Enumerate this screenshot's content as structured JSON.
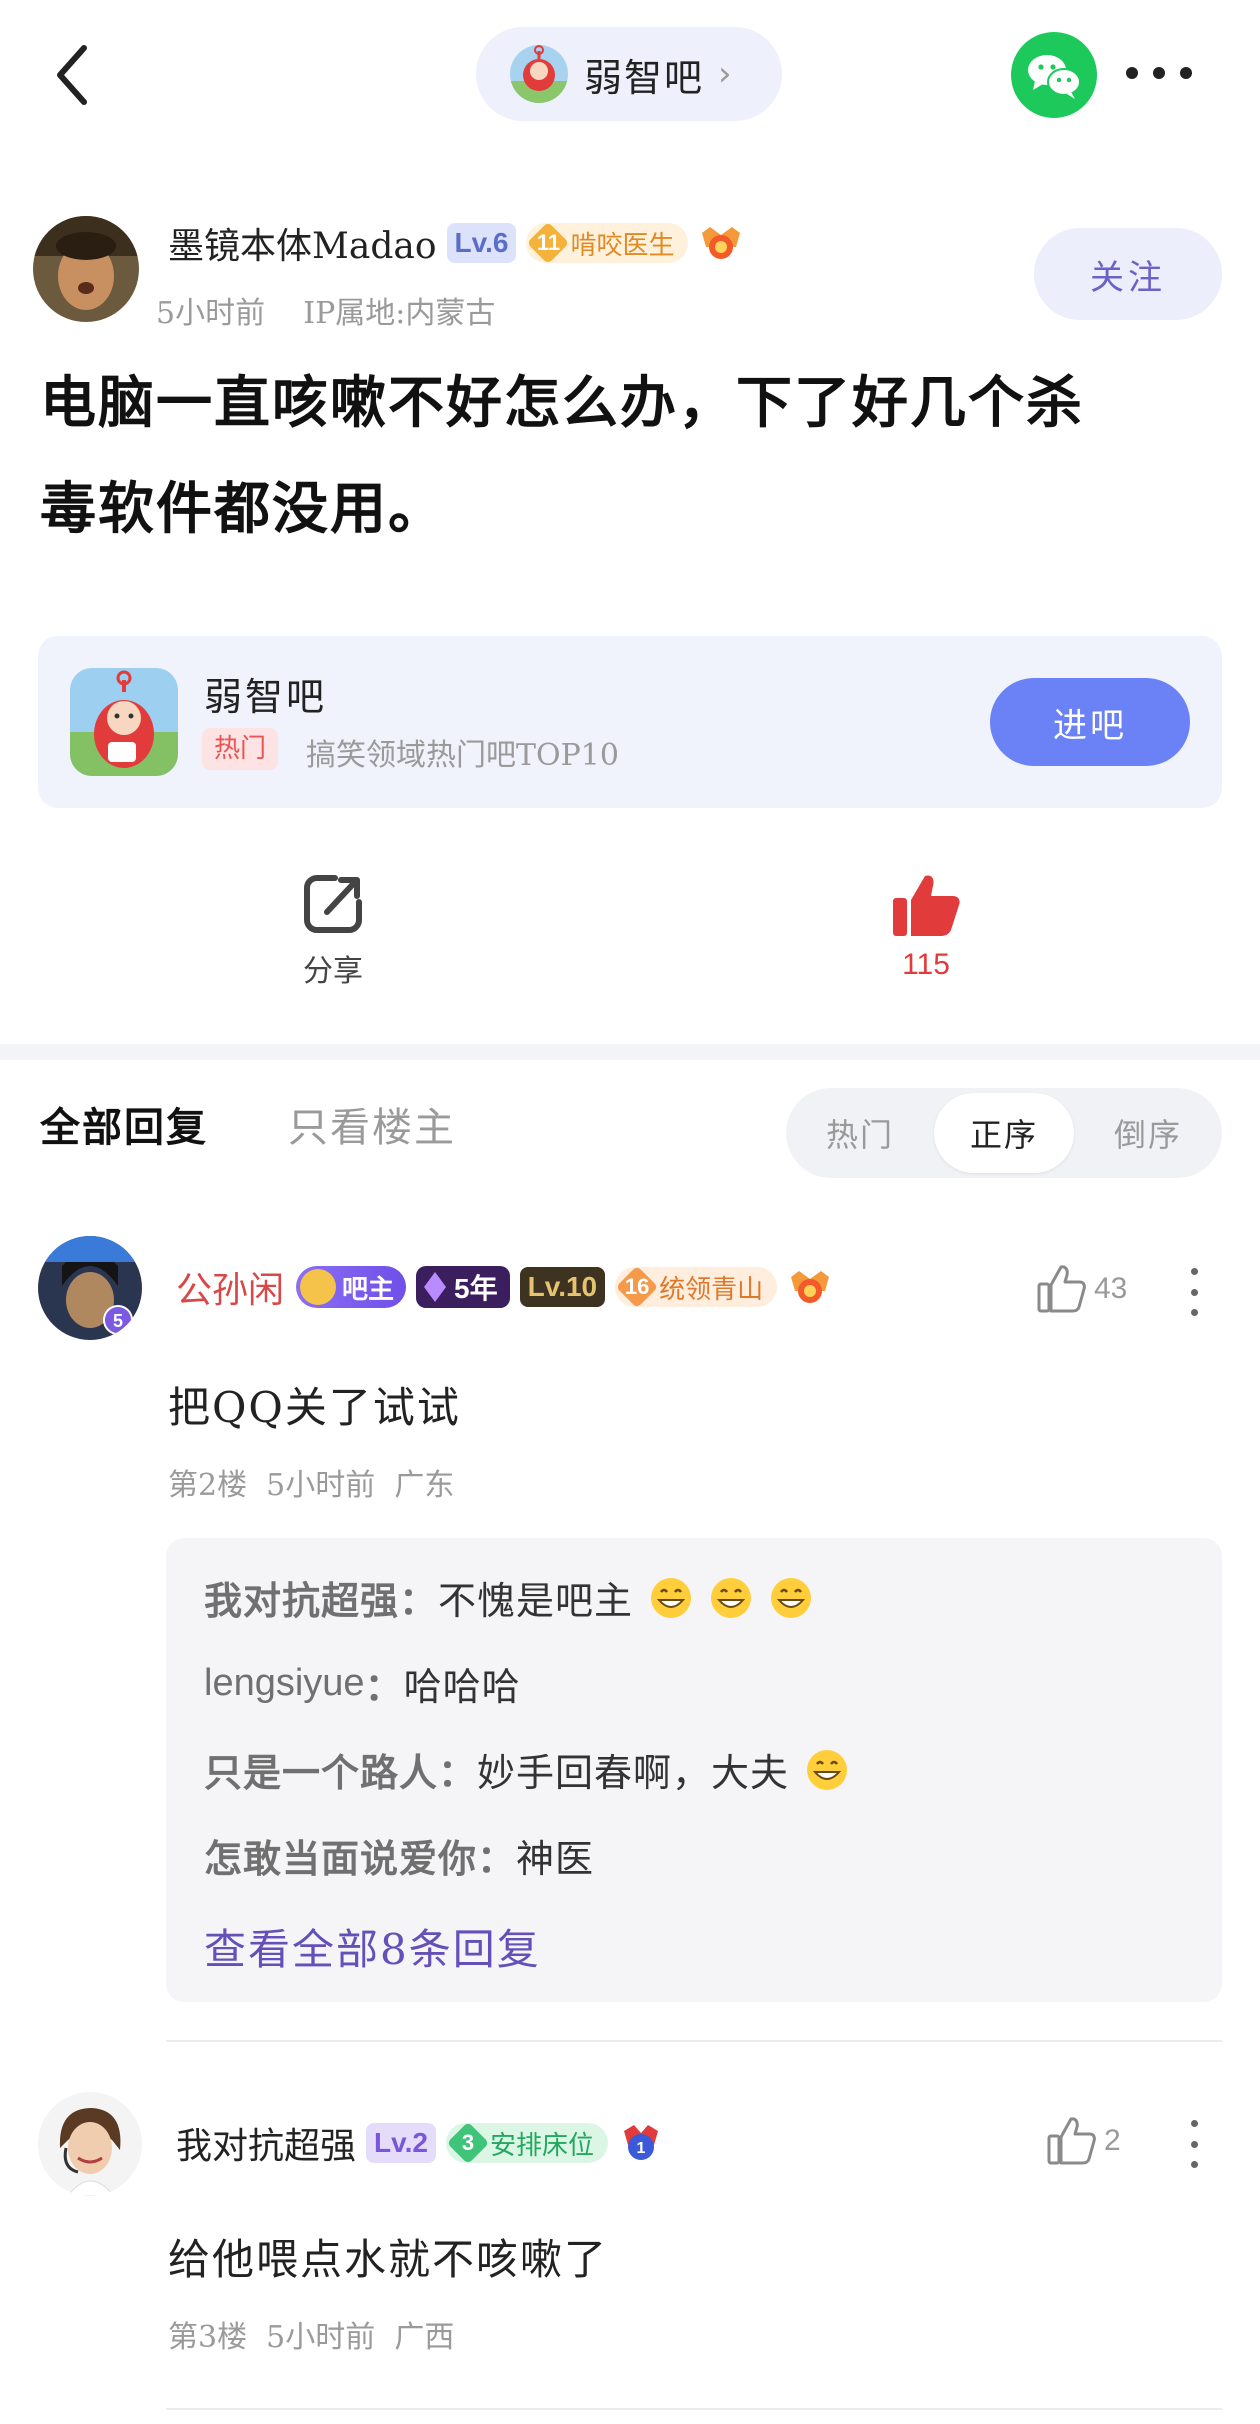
{
  "nav": {
    "forum_name": "弱智吧",
    "chevron": "›"
  },
  "post": {
    "author": "墨镜本体Madao",
    "level": "Lv.6",
    "title_badge_num": "11",
    "title_badge_text": "啃咬医生",
    "time": "5小时前",
    "ip": "IP属地:内蒙古",
    "follow_label": "关注",
    "title_line1": "电脑一直咳嗽不好怎么办，下了好几个杀",
    "title_line2": "毒软件都没用。"
  },
  "forum_card": {
    "name": "弱智吧",
    "hot_tag": "热门",
    "desc": "搞笑领域热门吧TOP10",
    "join_label": "进吧"
  },
  "actions": {
    "share_label": "分享",
    "like_count": "115"
  },
  "replies_tabs": {
    "all": "全部回复",
    "op_only": "只看楼主",
    "sort_hot": "热门",
    "sort_asc": "正序",
    "sort_desc": "倒序"
  },
  "comments": [
    {
      "user": "公孙闲",
      "role_badge": "吧主",
      "year_badge": "5年",
      "level": "Lv.10",
      "title_badge_num": "16",
      "title_badge_text": "统领青山",
      "avatar_badge": "5",
      "likes": "43",
      "text": "把QQ关了试试",
      "floor": "第2楼",
      "time": "5小时前",
      "location": "广东",
      "sub_replies": [
        {
          "user": "我对抗超强",
          "text": "不愧是吧主",
          "emoji_count": 3
        },
        {
          "user": "lengsiyue",
          "text": "哈哈哈",
          "emoji_count": 0
        },
        {
          "user": "只是一个路人",
          "text": "妙手回春啊，大夫",
          "emoji_count": 1
        },
        {
          "user": "怎敢当面说爱你",
          "text": "神医",
          "emoji_count": 0
        }
      ],
      "view_all": "查看全部8条回复"
    },
    {
      "user": "我对抗超强",
      "level": "Lv.2",
      "title_badge_num": "3",
      "title_badge_text": "安排床位",
      "rank_medal": "1",
      "likes": "2",
      "text": "给他喂点水就不咳嗽了",
      "floor": "第3楼",
      "time": "5小时前",
      "location": "广西"
    }
  ],
  "colors": {
    "accent": "#6a82f6",
    "like_red": "#e23b3b",
    "wechat_green": "#1cc95a",
    "link_purple": "#6450b8"
  }
}
